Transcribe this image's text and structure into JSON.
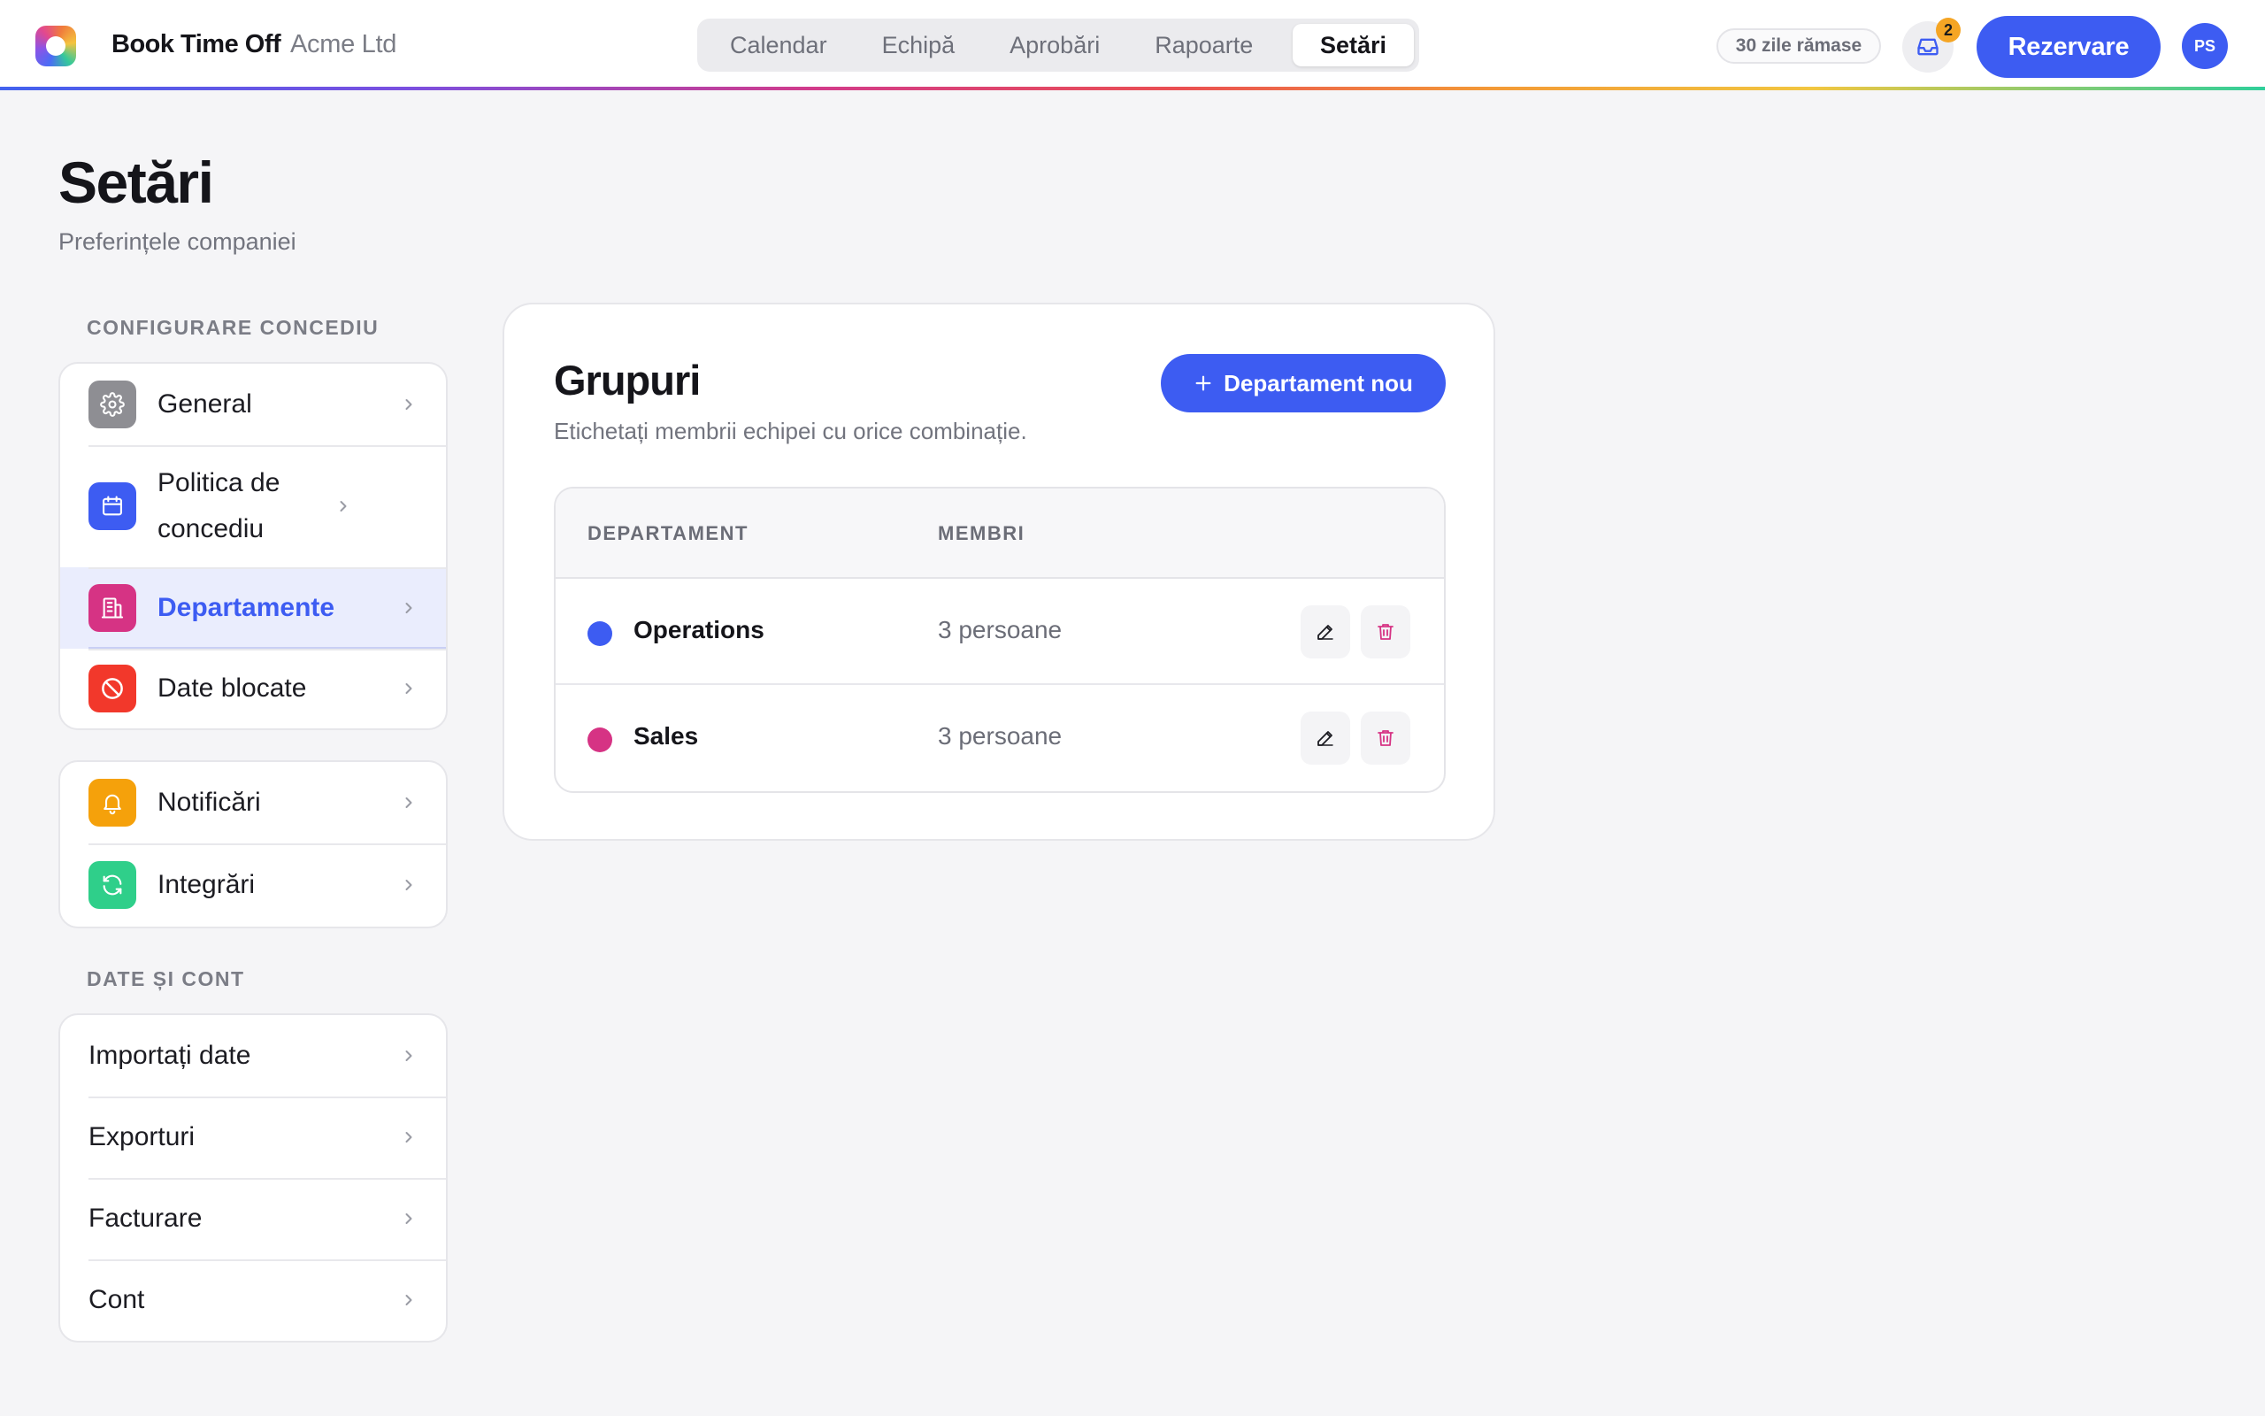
{
  "header": {
    "app_name": "Book Time Off",
    "company": "Acme Ltd",
    "nav": [
      "Calendar",
      "Echipă",
      "Aprobări",
      "Rapoarte",
      "Setări"
    ],
    "active_tab": "Setări",
    "days_left": "30 zile rămase",
    "inbox_count": "2",
    "book_button": "Rezervare",
    "avatar_initials": "PS"
  },
  "page": {
    "title": "Setări",
    "subtitle": "Preferințele companiei"
  },
  "sidebar": {
    "section1_label": "CONFIGURARE CONCEDIU",
    "leave_items": [
      {
        "label": "General",
        "icon": "gear-icon",
        "color": "#8e8e93"
      },
      {
        "label": "Politica de concediu",
        "icon": "calendar-icon",
        "color": "#3d5cf2"
      },
      {
        "label": "Departamente",
        "icon": "building-icon",
        "color": "#d63384",
        "active": true
      },
      {
        "label": "Date blocate",
        "icon": "blocked-icon",
        "color": "#f2382b"
      }
    ],
    "other_items": [
      {
        "label": "Notificări",
        "icon": "bell-icon",
        "color": "#f5a10b"
      },
      {
        "label": "Integrări",
        "icon": "sync-icon",
        "color": "#2fcf8a"
      }
    ],
    "section2_label": "DATE ȘI CONT",
    "account_items": [
      {
        "label": "Importați date"
      },
      {
        "label": "Exporturi"
      },
      {
        "label": "Facturare"
      },
      {
        "label": "Cont"
      }
    ]
  },
  "groups": {
    "title": "Grupuri",
    "description": "Etichetați membrii echipei cu orice combinație.",
    "new_button": "Departament nou",
    "columns": [
      "DEPARTAMENT",
      "MEMBRI"
    ],
    "rows": [
      {
        "name": "Operations",
        "members": "3 persoane",
        "color": "#3d5cf2"
      },
      {
        "name": "Sales",
        "members": "3 persoane",
        "color": "#d63384"
      }
    ]
  },
  "colors": {
    "accent": "#3d5cf2",
    "delete": "#d63384"
  }
}
